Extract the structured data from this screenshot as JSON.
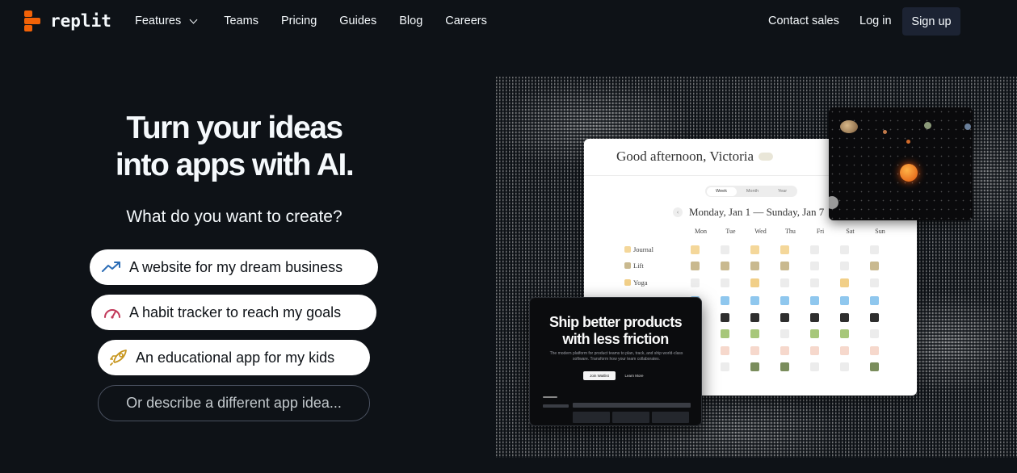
{
  "nav": {
    "logo_text": "replit",
    "links": [
      "Features",
      "Teams",
      "Pricing",
      "Guides",
      "Blog",
      "Careers"
    ],
    "contact_sales": "Contact sales",
    "login": "Log in",
    "signup": "Sign up"
  },
  "hero": {
    "title_line1": "Turn your ideas",
    "title_line2": "into apps with AI.",
    "subtitle": "What do you want to create?",
    "suggestions": [
      {
        "label": "A website for my dream business",
        "icon": "trend-up-icon",
        "color": "#2a6bb5"
      },
      {
        "label": "A habit tracker to reach my goals",
        "icon": "gauge-icon",
        "color": "#c23a5a"
      },
      {
        "label": "An educational app for my kids",
        "icon": "rocket-icon",
        "color": "#c7951c"
      }
    ],
    "describe_label": "Or describe a different app idea..."
  },
  "calendar_preview": {
    "greeting": "Good afternoon, Victoria",
    "view_tabs": [
      "Week",
      "Month",
      "Year"
    ],
    "range": "Monday, Jan 1 — Sunday, Jan 7",
    "days": [
      "Mon",
      "Tue",
      "Wed",
      "Thu",
      "Fri",
      "Sat",
      "Sun"
    ],
    "habits": [
      "Journal",
      "Lift",
      "Yoga"
    ]
  },
  "product_preview": {
    "title_line1": "Ship better products",
    "title_line2": "with less friction",
    "description": "The modern platform for product teams to plan, track, and ship world-class software. Transform how your team collaborates.",
    "primary_button": "Join Waitlist",
    "secondary_button": "Learn More"
  },
  "colors": {
    "background": "#0e1217",
    "brand_orange": "#f26207",
    "signup_bg": "#1c2333"
  }
}
